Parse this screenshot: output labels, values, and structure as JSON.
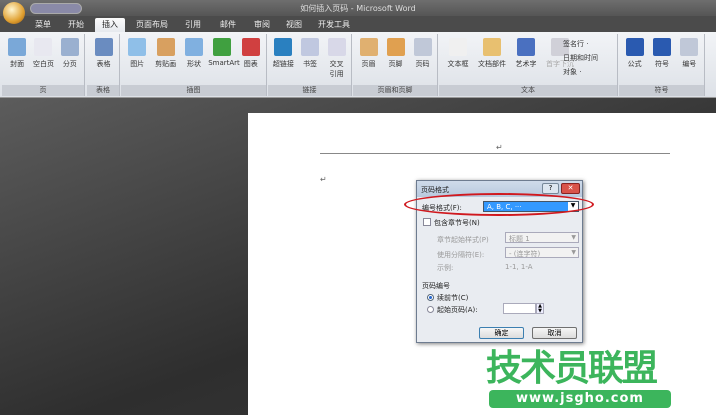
{
  "window": {
    "title": "如何插入页码 - Microsoft Word"
  },
  "tabs": [
    "菜单",
    "开始",
    "插入",
    "页面布局",
    "引用",
    "邮件",
    "审阅",
    "视图",
    "开发工具"
  ],
  "active_tab": "插入",
  "ribbon": {
    "groups": [
      {
        "label": "页",
        "buttons": [
          "封面",
          "空白页",
          "分页"
        ]
      },
      {
        "label": "表格",
        "buttons": [
          "表格"
        ]
      },
      {
        "label": "插图",
        "buttons": [
          "图片",
          "剪贴画",
          "形状",
          "SmartArt",
          "图表"
        ]
      },
      {
        "label": "链接",
        "buttons": [
          "超链接",
          "书签",
          "交叉\n引用"
        ]
      },
      {
        "label": "页眉和页脚",
        "buttons": [
          "页眉",
          "页脚",
          "页码"
        ]
      },
      {
        "label": "文本",
        "buttons": [
          "文本框",
          "文档部件",
          "艺术字",
          "首字下沉"
        ],
        "small": [
          "签名行 ·",
          "日期和时间",
          "对象 ·"
        ]
      },
      {
        "label": "符号",
        "buttons": [
          "公式",
          "符号",
          "编号"
        ]
      }
    ]
  },
  "dialog": {
    "title": "页码格式",
    "number_format_label": "编号格式(F):",
    "number_format_value": "A, B, C, ···",
    "include_chapter_label": "包含章节号(N)",
    "chapter_style_label": "章节起始样式(P)",
    "chapter_style_value": "标题 1",
    "separator_label": "使用分隔符(E):",
    "separator_value": "-  (连字符)",
    "example_label": "示例:",
    "example_value": "1-1, 1-A",
    "page_numbering_label": "页码编号",
    "continue_label": "续前节(C)",
    "start_at_label": "起始页码(A):",
    "start_at_value": "",
    "ok": "确定",
    "cancel": "取消",
    "selected_option": "续前节"
  },
  "watermark": {
    "text": "技术员联盟",
    "url": "www.jsgho.com",
    "color": "#3cb55c"
  },
  "colors": {
    "highlight_oval": "#d0181e",
    "selection": "#3399ff"
  }
}
